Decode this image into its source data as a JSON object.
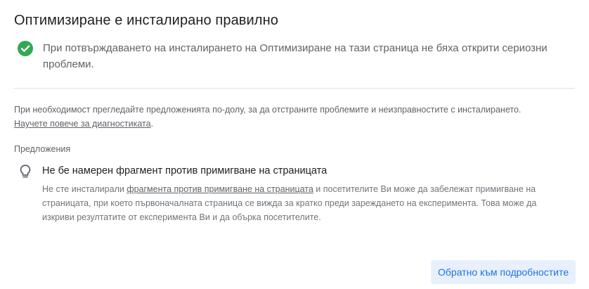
{
  "dialog": {
    "title": "Оптимизиране е инсталирано правилно",
    "status": {
      "icon": "check-circle-icon",
      "text": "При потвърждаването на инсталирането на Оптимизиране на тази страница не бяха открити сериозни проблеми.",
      "color": "#34a853"
    },
    "intro": {
      "text": "При необходимост прегледайте предложенията по-долу, за да отстраните проблемите и неизправностите с инсталирането.",
      "link_label": "Научете повече за диагностиката",
      "trailing": "."
    },
    "suggestions_label": "Предложения",
    "suggestion": {
      "icon": "lightbulb-icon",
      "title": "Не бе намерен фрагмент против примигване на страницата",
      "body_before": "Не сте инсталирали ",
      "body_link": "фрагмента против примигване на страницата",
      "body_after": " и посетителите Ви може да забележат примигване на страницата, при което първоначалната страница се вижда за кратко преди зареждането на експеримента. Това може да изкриви резултатите от експеримента Ви и да обърка посетителите."
    },
    "back_button_label": "Обратно към подробностите",
    "colors": {
      "accent": "#1a73e8",
      "button_bg": "#e8f0fe",
      "success": "#34a853",
      "secondary_text": "#5f6368"
    }
  }
}
